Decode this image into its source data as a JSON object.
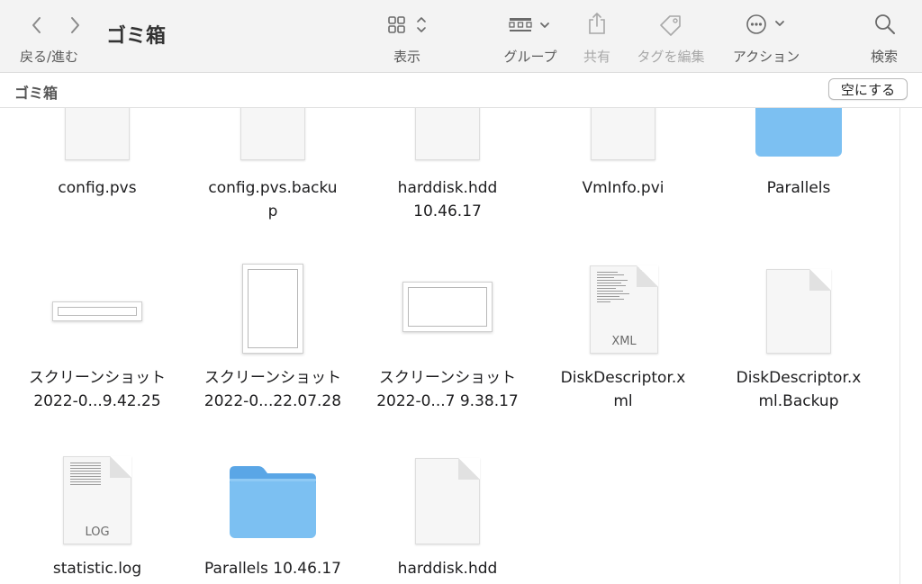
{
  "toolbar": {
    "window_title": "ゴミ箱",
    "nav_label": "戻る/進む",
    "view_label": "表示",
    "group_label": "グループ",
    "share_label": "共有",
    "tags_label": "タグを編集",
    "action_label": "アクション",
    "search_label": "検索"
  },
  "pathbar": {
    "title": "ゴミ箱",
    "empty_button": "空にする"
  },
  "items": [
    {
      "name_line1": "config.pvs",
      "name_line2": "",
      "icon": "document-icon"
    },
    {
      "name_line1": "config.pvs.backu",
      "name_line2": "p",
      "icon": "document-icon"
    },
    {
      "name_line1": "harddisk.hdd",
      "name_line2": "10.46.17",
      "icon": "document-icon"
    },
    {
      "name_line1": "VmInfo.pvi",
      "name_line2": "",
      "icon": "document-icon"
    },
    {
      "name_line1": "Parallels",
      "name_line2": "",
      "icon": "folder-icon"
    },
    {
      "name_line1": "スクリーンショット",
      "name_line2": "2022-0...9.42.25",
      "icon": "screenshot-icon"
    },
    {
      "name_line1": "スクリーンショット",
      "name_line2": "2022-0...22.07.28",
      "icon": "screenshot-icon"
    },
    {
      "name_line1": "スクリーンショット",
      "name_line2": "2022-0...7 9.38.17",
      "icon": "screenshot-icon"
    },
    {
      "name_line1": "DiskDescriptor.x",
      "name_line2": "ml",
      "icon": "xml-document-icon",
      "badge": "XML"
    },
    {
      "name_line1": "DiskDescriptor.x",
      "name_line2": "ml.Backup",
      "icon": "document-icon"
    },
    {
      "name_line1": "statistic.log",
      "name_line2": "",
      "icon": "log-document-icon",
      "badge": "LOG"
    },
    {
      "name_line1": "Parallels 10.46.17",
      "name_line2": "",
      "icon": "folder-icon"
    },
    {
      "name_line1": "harddisk.hdd",
      "name_line2": "",
      "icon": "document-icon"
    }
  ],
  "colors": {
    "folder_body": "#7cc0f2",
    "folder_tab": "#5aa6e6",
    "toolbar_bg": "#f3f3f3"
  }
}
